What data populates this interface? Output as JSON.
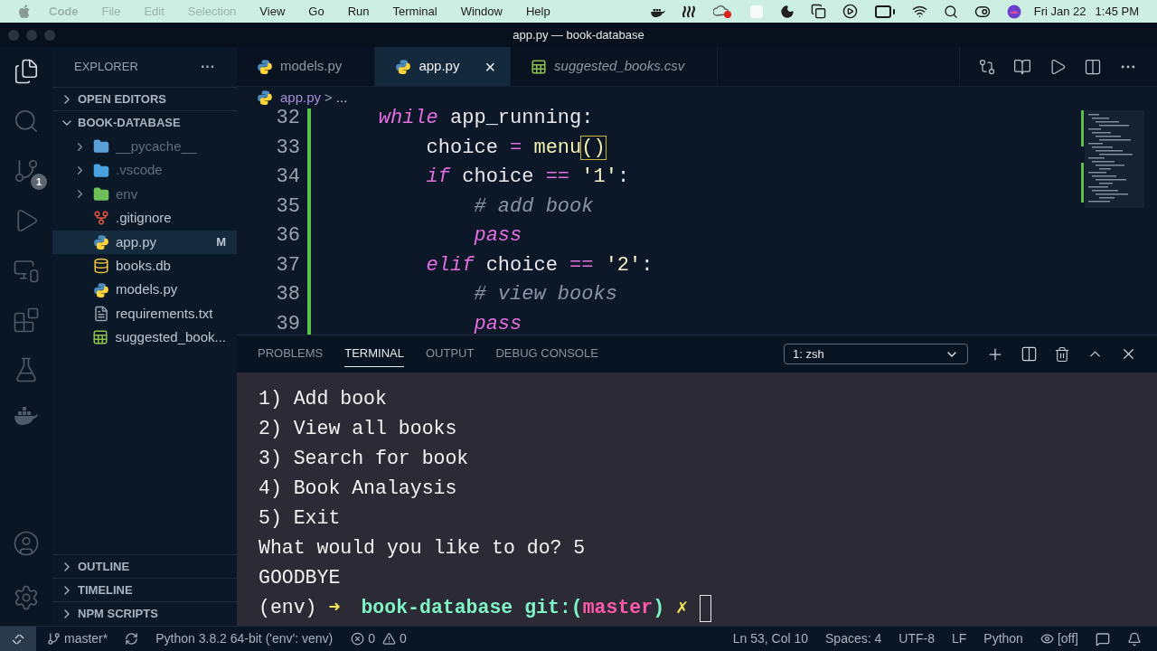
{
  "menubar": {
    "items": [
      {
        "label": "Code",
        "disabled": true,
        "bold": true
      },
      {
        "label": "File",
        "disabled": true,
        "bold": false
      },
      {
        "label": "Edit",
        "disabled": true,
        "bold": false
      },
      {
        "label": "Selection",
        "disabled": true,
        "bold": false
      },
      {
        "label": "View",
        "disabled": false,
        "bold": false
      },
      {
        "label": "Go",
        "disabled": false,
        "bold": false
      },
      {
        "label": "Run",
        "disabled": false,
        "bold": false
      },
      {
        "label": "Terminal",
        "disabled": false,
        "bold": false
      },
      {
        "label": "Window",
        "disabled": false,
        "bold": false
      },
      {
        "label": "Help",
        "disabled": false,
        "bold": false
      }
    ],
    "date": "Fri Jan 22",
    "time": "1:45 PM"
  },
  "window": {
    "title": "app.py — book-database"
  },
  "activity_bar": [
    {
      "kind": "files",
      "selected": true
    },
    {
      "kind": "search",
      "selected": false
    },
    {
      "kind": "git",
      "selected": false,
      "badge": "1"
    },
    {
      "kind": "run",
      "selected": false
    },
    {
      "kind": "remote",
      "selected": false
    },
    {
      "kind": "extensions",
      "selected": false
    },
    {
      "kind": "testing",
      "selected": false
    },
    {
      "kind": "docker",
      "selected": false
    }
  ],
  "explorer": {
    "title": "EXPLORER",
    "more": "···",
    "sections_top": [
      {
        "label": "OPEN EDITORS",
        "expanded": false
      }
    ],
    "project": {
      "label": "BOOK-DATABASE",
      "expanded": true,
      "children": [
        {
          "name": "__pycache__",
          "kind": "folder-python",
          "ignored": true,
          "expanded": false,
          "selected": false
        },
        {
          "name": ".vscode",
          "kind": "folder-vscode",
          "ignored": true,
          "expanded": false,
          "selected": false
        },
        {
          "name": "env",
          "kind": "folder-env",
          "ignored": true,
          "expanded": false,
          "selected": false
        },
        {
          "name": ".gitignore",
          "kind": "git",
          "ignored": false,
          "selected": false
        },
        {
          "name": "app.py",
          "kind": "python",
          "ignored": false,
          "selected": true,
          "badge": "M"
        },
        {
          "name": "books.db",
          "kind": "database",
          "ignored": false,
          "selected": false
        },
        {
          "name": "models.py",
          "kind": "python",
          "ignored": false,
          "selected": false
        },
        {
          "name": "requirements.txt",
          "kind": "text",
          "ignored": false,
          "selected": false
        },
        {
          "name": "suggested_book...",
          "kind": "csv",
          "ignored": false,
          "selected": false
        }
      ]
    },
    "sections_bottom": [
      {
        "label": "OUTLINE",
        "expanded": false
      },
      {
        "label": "TIMELINE",
        "expanded": false
      },
      {
        "label": "NPM SCRIPTS",
        "expanded": false
      }
    ]
  },
  "tabs": [
    {
      "label": "models.py",
      "kind": "python",
      "selected": false,
      "preview": false
    },
    {
      "label": "app.py",
      "kind": "python",
      "selected": true,
      "preview": false,
      "close": "×"
    },
    {
      "label": "suggested_books.csv",
      "kind": "csv",
      "selected": false,
      "preview": true
    }
  ],
  "breadcrumb": {
    "file": "app.py",
    "separator": ">",
    "rest": "..."
  },
  "code": [
    {
      "number": "32",
      "tokens": [
        {
          "kind": "keyword",
          "text": "    while"
        },
        {
          "kind": "plain",
          "text": " app_running:"
        }
      ]
    },
    {
      "number": "33",
      "tokens": [
        {
          "kind": "plain",
          "text": "        choice "
        },
        {
          "kind": "keyword",
          "text": "="
        },
        {
          "kind": "function",
          "text": " menu"
        },
        {
          "kind": "paren",
          "text": "()"
        }
      ]
    },
    {
      "number": "34",
      "tokens": [
        {
          "kind": "keyword",
          "text": "        if"
        },
        {
          "kind": "plain",
          "text": " choice "
        },
        {
          "kind": "operator",
          "text": "== "
        },
        {
          "kind": "string",
          "text": "'1'"
        },
        {
          "kind": "plain",
          "text": ":"
        }
      ]
    },
    {
      "number": "35",
      "tokens": [
        {
          "kind": "comment",
          "text": "            # add book"
        }
      ]
    },
    {
      "number": "36",
      "tokens": [
        {
          "kind": "keyword",
          "text": "            pass"
        }
      ]
    },
    {
      "number": "37",
      "tokens": [
        {
          "kind": "keyword",
          "text": "        elif"
        },
        {
          "kind": "plain",
          "text": " choice "
        },
        {
          "kind": "operator",
          "text": "== "
        },
        {
          "kind": "string",
          "text": "'2'"
        },
        {
          "kind": "plain",
          "text": ":"
        }
      ]
    },
    {
      "number": "38",
      "tokens": [
        {
          "kind": "comment",
          "text": "            # view books"
        }
      ]
    },
    {
      "number": "39",
      "tokens": [
        {
          "kind": "keyword",
          "text": "            pass"
        }
      ]
    }
  ],
  "panel": {
    "tabs": [
      {
        "label": "PROBLEMS",
        "selected": false
      },
      {
        "label": "TERMINAL",
        "selected": true
      },
      {
        "label": "OUTPUT",
        "selected": false
      },
      {
        "label": "DEBUG CONSOLE",
        "selected": false
      }
    ],
    "terminal_select": "1: zsh",
    "terminal": [
      {
        "segments": [
          {
            "kind": "plain",
            "text": "1) Add book"
          }
        ]
      },
      {
        "segments": [
          {
            "kind": "plain",
            "text": "2) View all books"
          }
        ]
      },
      {
        "segments": [
          {
            "kind": "plain",
            "text": "3) Search for book"
          }
        ]
      },
      {
        "segments": [
          {
            "kind": "plain",
            "text": "4) Book Analaysis"
          }
        ]
      },
      {
        "segments": [
          {
            "kind": "plain",
            "text": "5) Exit"
          }
        ]
      },
      {
        "segments": [
          {
            "kind": "plain",
            "text": "What would you like to do? 5"
          }
        ]
      },
      {
        "segments": [
          {
            "kind": "plain",
            "text": "GOODBYE"
          }
        ]
      },
      {
        "segments": [
          {
            "kind": "plain",
            "text": "(env)"
          },
          {
            "kind": "arrow",
            "text": "➜"
          },
          {
            "kind": "dir",
            "text": "book-database"
          },
          {
            "kind": "git",
            "text": "git:("
          },
          {
            "kind": "branch",
            "text": "master"
          },
          {
            "kind": "git",
            "text": ")"
          },
          {
            "kind": "dirty",
            "text": "✗"
          }
        ],
        "cursor": true
      }
    ]
  },
  "status_bar": {
    "branch": "master*",
    "interpreter": "Python 3.8.2 64-bit ('env': venv)",
    "errors": "0",
    "warnings": "0",
    "right": [
      {
        "kind": "text",
        "text": "Ln 53, Col 10"
      },
      {
        "kind": "text",
        "text": "Spaces: 4"
      },
      {
        "kind": "text",
        "text": "UTF-8"
      },
      {
        "kind": "text",
        "text": "LF"
      },
      {
        "kind": "text",
        "text": "Python"
      },
      {
        "kind": "eye",
        "text": "[off]"
      }
    ]
  }
}
